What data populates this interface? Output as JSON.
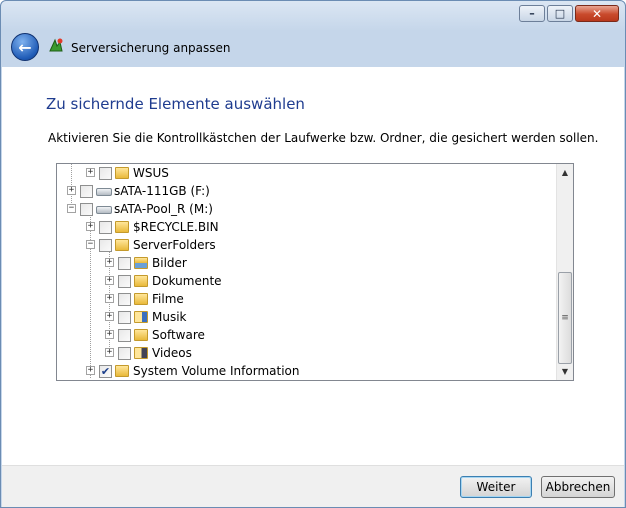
{
  "window": {
    "min_label": "–",
    "max_label": "□",
    "close_label": "✕"
  },
  "nav": {
    "title": "Serversicherung anpassen",
    "back_glyph": "←"
  },
  "page": {
    "heading": "Zu sichernde Elemente auswählen",
    "description": "Aktivieren Sie die Kontrollkästchen der Laufwerke bzw. Ordner, die gesichert werden sollen."
  },
  "tree": {
    "items": [
      {
        "label": "WSUS",
        "icon": "folder-icon",
        "checked": false,
        "expander": "+"
      },
      {
        "label": "sATA-111GB (F:)",
        "icon": "drive-icon",
        "checked": false,
        "expander": "+"
      },
      {
        "label": "sATA-Pool_R (M:)",
        "icon": "drive-icon",
        "checked": false,
        "expander": "−"
      },
      {
        "label": "$RECYCLE.BIN",
        "icon": "folder-icon",
        "checked": false,
        "expander": "+"
      },
      {
        "label": "ServerFolders",
        "icon": "folder-icon",
        "checked": false,
        "expander": "−"
      },
      {
        "label": "Bilder",
        "icon": "pictures-folder-icon",
        "checked": false,
        "expander": "+"
      },
      {
        "label": "Dokumente",
        "icon": "folder-icon",
        "checked": false,
        "expander": "+"
      },
      {
        "label": "Filme",
        "icon": "folder-icon",
        "checked": false,
        "expander": "+"
      },
      {
        "label": "Musik",
        "icon": "music-folder-icon",
        "checked": false,
        "expander": "+"
      },
      {
        "label": "Software",
        "icon": "folder-icon",
        "checked": false,
        "expander": "+"
      },
      {
        "label": "Videos",
        "icon": "videos-folder-icon",
        "checked": false,
        "expander": "+"
      },
      {
        "label": "System Volume Information",
        "icon": "folder-icon",
        "checked": true,
        "expander": "+"
      }
    ],
    "check_glyph": "✔"
  },
  "scrollbar": {
    "up_glyph": "▲",
    "down_glyph": "▼",
    "grip_glyph": "≡"
  },
  "buttons": {
    "next": "Weiter",
    "cancel": "Abbrechen"
  }
}
